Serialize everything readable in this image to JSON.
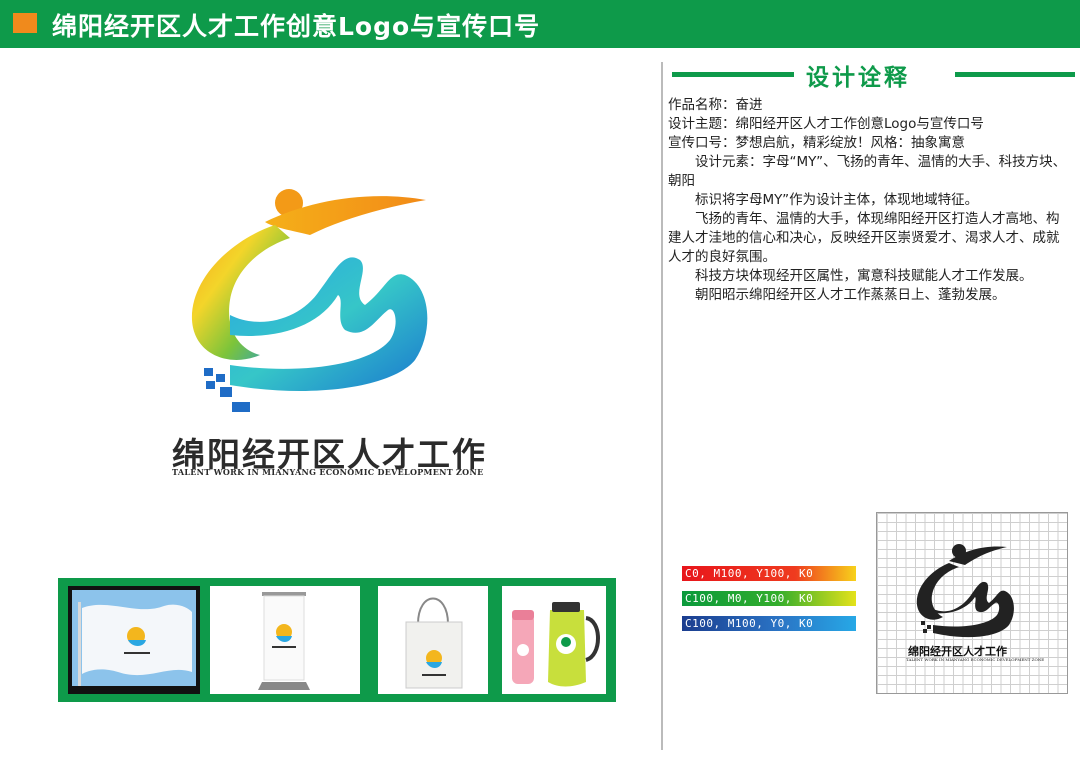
{
  "header": {
    "title": "绵阳经开区人才工作创意Logo与宣传口号"
  },
  "logo": {
    "name_cn": "绵阳经开区人才工作",
    "name_en": "TALENT WORK IN MIANYANG ECONOMIC DEVELOPMENT ZONE",
    "mini_cn": "绵阳经开区人才工作",
    "mini_en": "TALENT WORK IN MIANYANG ECONOMIC DEVELOPMENT ZONE",
    "grid_cn": "绵阳经开区人才工作",
    "grid_en": "TALENT WORK IN MIANYANG ECONOMIC DEVELOPMENT ZONE"
  },
  "section": {
    "title": "设计诠释"
  },
  "description": {
    "p1": "作品名称：奋进",
    "p2": "设计主题：绵阳经开区人才工作创意Logo与宣传口号",
    "p3": "宣传口号：梦想启航，精彩绽放！风格：抽象寓意",
    "p4": "设计元素：字母“MY”、飞扬的青年、温情的大手、科技方块、朝阳",
    "p5": "标识将字母MY”作为设计主体，体现地域特征。",
    "p6": "飞扬的青年、温情的大手，体现绵阳经开区打造人才高地、构建人才洼地的信心和决心，反映经开区崇贤爱才、渴求人才、成就人才的良好氛围。",
    "p7": "科技方块体现经开区属性，寓意科技赋能人才工作发展。",
    "p8": "朝阳昭示绵阳经开区人才工作蒸蒸日上、蓬勃发展。"
  },
  "colors": {
    "c1": "C0, M100, Y100, K0",
    "c2": "C100, M0, Y100, K0",
    "c3": "C100, M100, Y0, K0",
    "brand_green": "#0e9a4a",
    "accent_orange": "#f08a1c"
  }
}
